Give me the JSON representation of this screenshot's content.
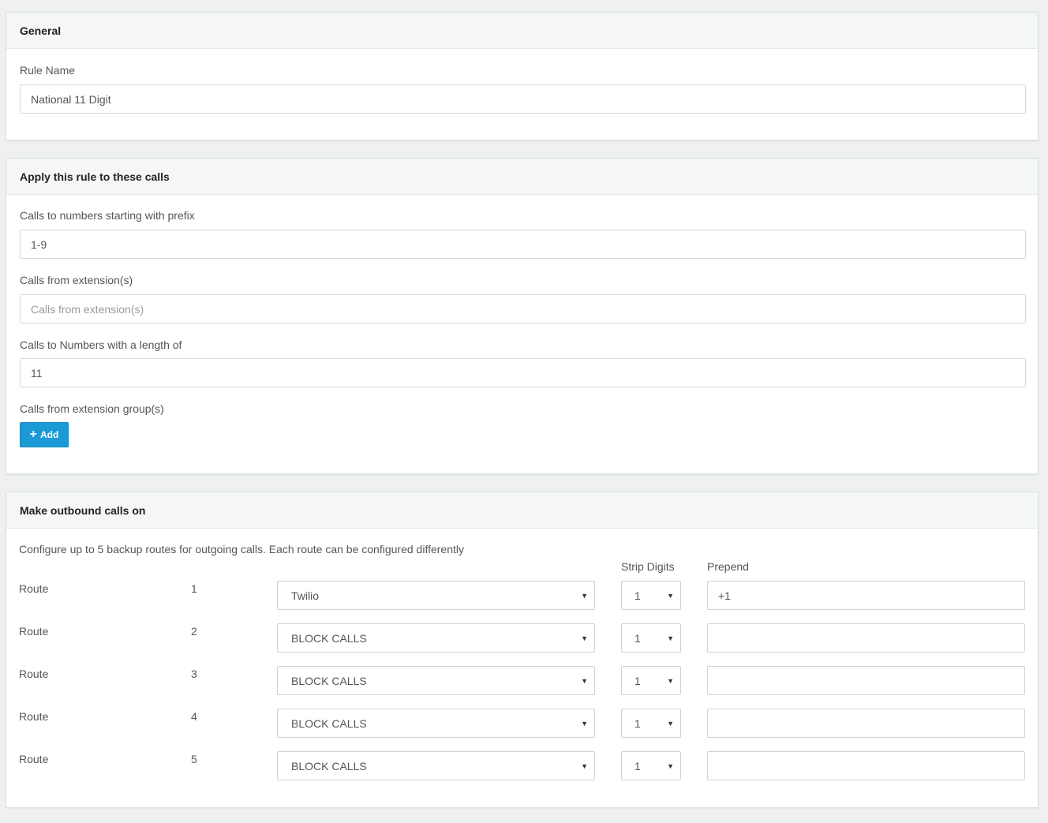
{
  "general": {
    "title": "General",
    "rule_name_label": "Rule Name",
    "rule_name_value": "National 11 Digit"
  },
  "apply": {
    "title": "Apply this rule to these calls",
    "prefix_label": "Calls to numbers starting with prefix",
    "prefix_value": "1-9",
    "extensions_label": "Calls from extension(s)",
    "extensions_placeholder": "Calls from extension(s)",
    "length_label": "Calls to Numbers with a length of",
    "length_value": "11",
    "groups_label": "Calls from extension group(s)",
    "add_button": "Add",
    "add_icon": "plus-icon"
  },
  "outbound": {
    "title": "Make outbound calls on",
    "intro": "Configure up to 5 backup routes for outgoing calls. Each route can be configured differently",
    "strip_digits_header": "Strip Digits",
    "prepend_header": "Prepend",
    "routes": [
      {
        "label": "Route",
        "number": "1",
        "trunk": "Twilio",
        "strip": "1",
        "prepend": "+1"
      },
      {
        "label": "Route",
        "number": "2",
        "trunk": "BLOCK CALLS",
        "strip": "1",
        "prepend": ""
      },
      {
        "label": "Route",
        "number": "3",
        "trunk": "BLOCK CALLS",
        "strip": "1",
        "prepend": ""
      },
      {
        "label": "Route",
        "number": "4",
        "trunk": "BLOCK CALLS",
        "strip": "1",
        "prepend": ""
      },
      {
        "label": "Route",
        "number": "5",
        "trunk": "BLOCK CALLS",
        "strip": "1",
        "prepend": ""
      }
    ]
  },
  "colors": {
    "page_bg": "#eef0f1",
    "header_bg": "#f5f6f6",
    "accent": "#1c9ad6"
  }
}
